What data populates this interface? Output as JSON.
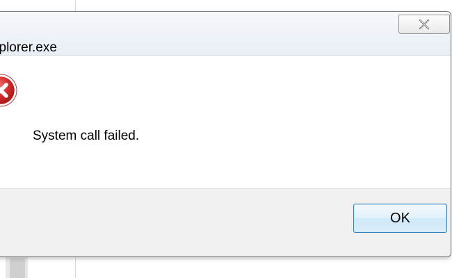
{
  "dialog": {
    "title": "xplorer.exe",
    "message": "System call failed.",
    "ok_label": "OK"
  },
  "icons": {
    "close": "close-icon",
    "error": "error-icon"
  },
  "colors": {
    "error_red": "#d32b2b",
    "ok_border": "#3c7fb1"
  }
}
